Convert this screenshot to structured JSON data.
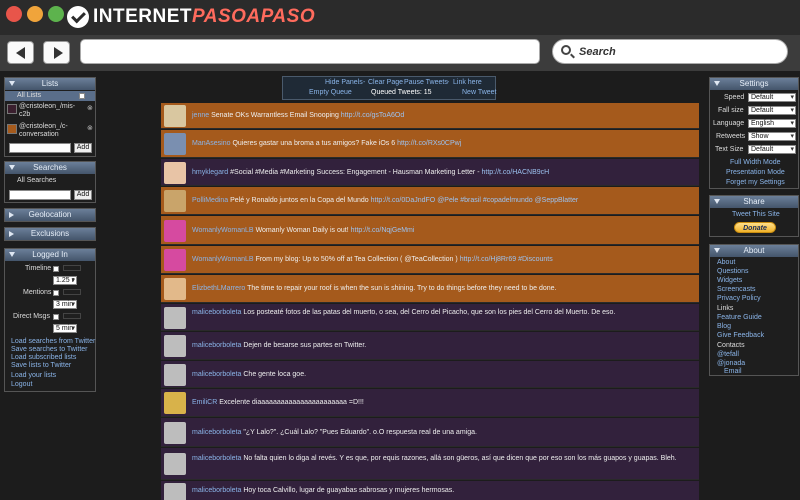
{
  "logo": {
    "part1": "INTERNET",
    "part2": "PASOAPASO"
  },
  "browser": {
    "search_placeholder": "Search",
    "url_value": ""
  },
  "colors": {
    "close": "#e8554a",
    "minimize": "#f0a43b",
    "maximize": "#5db34d"
  },
  "top_controls": {
    "hide_panels": "Hide Panels",
    "clear_page": "Clear Page",
    "pause_tweets": "Pause Tweets",
    "link_here": "Link here",
    "empty_queue": "Empty Queue",
    "queued_label": "Queued Tweets: 15",
    "new_tweet": "New Tweet"
  },
  "lists": {
    "title": "Lists",
    "all_lists": "All Lists",
    "items": [
      {
        "line1": "@cristoleon_/mis-",
        "line2": "c2b",
        "color": "#3a1f2e"
      },
      {
        "line1": "@cristoleon_/c-",
        "line2": "conversation",
        "color": "#a55a1c"
      }
    ],
    "add": "Add"
  },
  "searches": {
    "title": "Searches",
    "all": "All Searches",
    "add": "Add"
  },
  "geolocation": {
    "title": "Geolocation"
  },
  "exclusions": {
    "title": "Exclusions"
  },
  "logged_in": {
    "title": "Logged In",
    "timeline": "Timeline",
    "timeline_val": "1.25 r",
    "mentions": "Mentions",
    "mentions_val": "3 min",
    "direct": "Direct Msgs",
    "direct_val": "5 min",
    "links": [
      "Load searches from Twitter",
      "Save searches to Twitter",
      "Load subscribed lists",
      "Save lists to Twitter",
      "Load your lists",
      "Logout"
    ]
  },
  "settings": {
    "title": "Settings",
    "rows": [
      {
        "label": "Speed",
        "value": "Default"
      },
      {
        "label": "Fall size",
        "value": "Default"
      },
      {
        "label": "Language",
        "value": "English"
      },
      {
        "label": "Retweets",
        "value": "Show"
      },
      {
        "label": "Text Size",
        "value": "Default"
      }
    ],
    "links": [
      "Full Width Mode",
      "Presentation Mode",
      "Forget my Settings"
    ]
  },
  "share": {
    "title": "Share",
    "link": "Tweet This Site",
    "donate": "Donate"
  },
  "about": {
    "title": "About",
    "links": [
      "About",
      "Questions",
      "Widgets",
      "Screencasts",
      "Privacy Policy"
    ],
    "links_head": "Links",
    "links2": [
      "Feature Guide",
      "Blog",
      "Give Feedback"
    ],
    "contacts_head": "Contacts",
    "contacts": [
      "@tefall",
      "@jonada",
      "Email"
    ]
  },
  "tweets": [
    {
      "user": "jenne",
      "text": "Senate OKs Warrantless Email Snooping",
      "url": "http://t.co/gsToA6Od",
      "tail": "",
      "theme": "orange",
      "av": "#d9c7a0"
    },
    {
      "user": "ManAsesino",
      "text": "Quieres gastar una broma a tus amigos? Fake iOs 6",
      "url": "http://t.co/RXs0CPwj",
      "tail": "",
      "theme": "orange",
      "av": "#7a8fb0"
    },
    {
      "user": "hmyklegard",
      "text": "#Social #Media #Marketing Success: Engagement - Hausman Marketing Letter -",
      "url": "http://t.co/HACNB9cH",
      "tail": "",
      "theme": "purple",
      "av": "#e8c4a6"
    },
    {
      "user": "PolliMedina",
      "text": "Pelé y Ronaldo juntos en la Copa del Mundo",
      "url": "http://t.co/0DaJndFO",
      "tail": "@Pele #brasil #copadelmundo @SeppBlatter",
      "theme": "orange",
      "av": "#c9a46a"
    },
    {
      "user": "WomanlyWomanLB",
      "text": "Womanly Woman Daily is out!",
      "url": "http://t.co/NqjGeMmi",
      "tail": "",
      "theme": "orange",
      "av": "#d64aa0"
    },
    {
      "user": "WomanlyWomanLB",
      "text": "From my blog: Up to 50% off at Tea Collection ( @TeaCollection )",
      "url": "http://t.co/Hj8Rr69",
      "tail": "#Discounts",
      "theme": "orange",
      "av": "#d64aa0"
    },
    {
      "user": "ElizbethLMarrero",
      "text": "The time to repair your roof is when the sun is shining. Try to do things before they need to be done.",
      "url": "",
      "tail": "",
      "theme": "orange",
      "av": "#e2b98a"
    },
    {
      "user": "maliceborboleta",
      "text": "Los posteaté fotos de las patas del muerto, o sea, del Cerro del Picacho, que son los pies del Cerro del Muerto. De eso.",
      "url": "",
      "tail": "",
      "theme": "purple",
      "av": "#bdbdbd"
    },
    {
      "user": "maliceborboleta",
      "text": "Dejen de besarse sus partes en Twitter.",
      "url": "",
      "tail": "",
      "theme": "purple",
      "av": "#bdbdbd"
    },
    {
      "user": "maliceborboleta",
      "text": "Che gente loca goe.",
      "url": "",
      "tail": "",
      "theme": "purple",
      "av": "#bdbdbd"
    },
    {
      "user": "EmiliCR",
      "text": "Excelente diaaaaaaaaaaaaaaaaaaaaaaa =D!!!",
      "url": "",
      "tail": "",
      "theme": "purple",
      "av": "#d8b24a"
    },
    {
      "user": "maliceborboleta",
      "text": "\"¿Y Lalo?\". ¿Cuál Lalo? \"Pues Eduardo\". o.O respuesta real de una amiga.",
      "url": "",
      "tail": "",
      "theme": "purple",
      "av": "#bdbdbd"
    },
    {
      "user": "maliceborboleta",
      "text": "No falta quien lo diga al revés. Y es que, por equis razones, allá son güeros, así que dicen que por eso son los más guapos y guapas. Bleh.",
      "url": "",
      "tail": "",
      "theme": "purple",
      "av": "#bdbdbd"
    },
    {
      "user": "maliceborboleta",
      "text": "Hoy toca Calvillo, lugar de guayabas sabrosas y mujeres hermosas.",
      "url": "",
      "tail": "",
      "theme": "purple",
      "av": "#bdbdbd"
    }
  ]
}
